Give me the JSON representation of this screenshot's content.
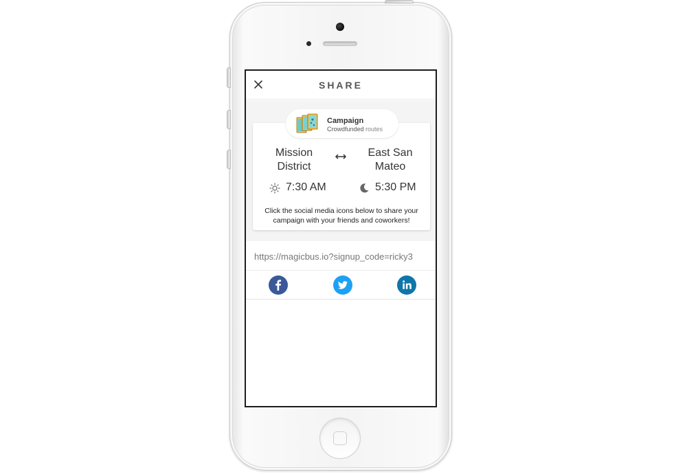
{
  "header": {
    "title": "SHARE",
    "close_icon": "close-icon"
  },
  "badge": {
    "icon": "campaign-cards-icon",
    "title": "Campaign",
    "subtitle_bold": "Crowdfunded",
    "subtitle_rest": " routes"
  },
  "route": {
    "origin_line1": "Mission",
    "origin_line2": "District",
    "destination_line1": "East San",
    "destination_line2": "Mateo",
    "direction_icon": "left-right-arrow-icon"
  },
  "times": {
    "morning_icon": "sun-icon",
    "morning": "7:30 AM",
    "evening_icon": "moon-icon",
    "evening": "5:30 PM"
  },
  "message": "Click the social media icons below to share your campaign with your friends and coworkers!",
  "share_link": "https://magicbus.io?signup_code=ricky3",
  "social": [
    {
      "name": "facebook",
      "icon": "facebook-icon",
      "color": "#3b5998"
    },
    {
      "name": "twitter",
      "icon": "twitter-icon",
      "color": "#1da1f2"
    },
    {
      "name": "linkedin",
      "icon": "linkedin-icon",
      "color": "#0e76a8"
    }
  ],
  "colors": {
    "screen_border": "#1c1c1c",
    "panel_background": "#f4f4f4",
    "text_primary": "#333333",
    "text_muted": "#777777"
  }
}
